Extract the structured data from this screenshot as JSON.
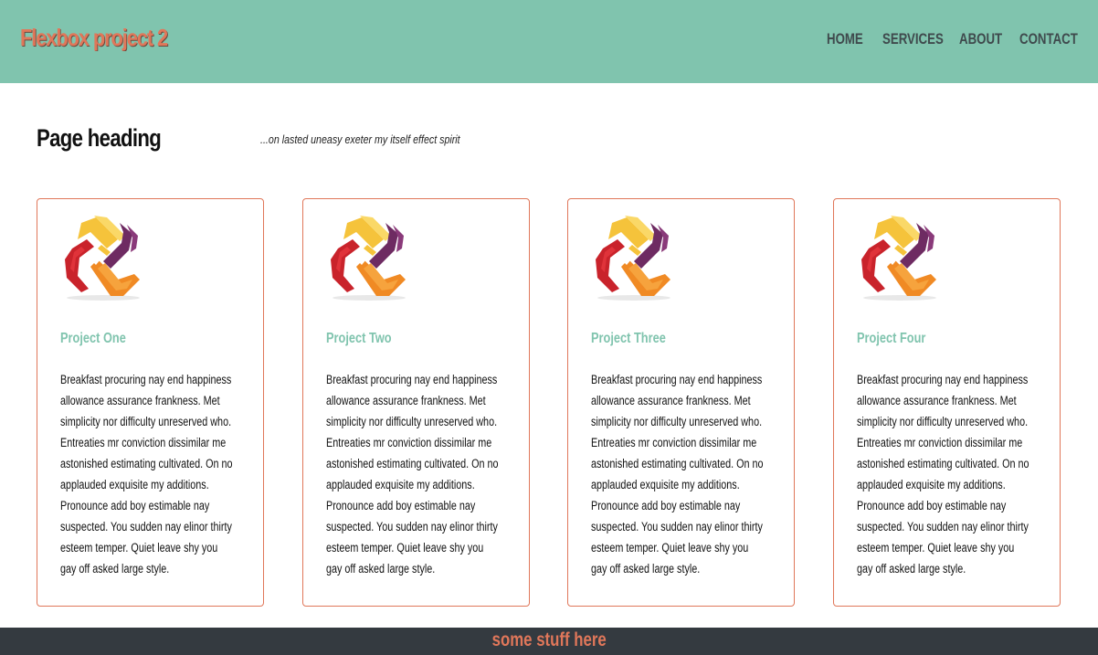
{
  "header": {
    "brand": "Flexbox project 2",
    "nav": [
      "HOME",
      "SERVICES",
      "ABOUT",
      "CONTACT"
    ]
  },
  "main": {
    "heading": "Page heading",
    "tagline": "...on lasted uneasy exeter my itself effect spirit",
    "cards": [
      {
        "title": "Project One",
        "body": "Breakfast procuring nay end happiness allowance assurance frankness. Met simplicity nor difficulty unreserved who. Entreaties mr conviction dissimilar me astonished estimating cultivated. On no applauded exquisite my additions. Pronounce add boy estimable nay suspected. You sudden nay elinor thirty esteem temper. Quiet leave shy you gay off asked large style.",
        "icon": "logo-icon"
      },
      {
        "title": "Project Two",
        "body": "Breakfast procuring nay end happiness allowance assurance frankness. Met simplicity nor difficulty unreserved who. Entreaties mr conviction dissimilar me astonished estimating cultivated. On no applauded exquisite my additions. Pronounce add boy estimable nay suspected. You sudden nay elinor thirty esteem temper. Quiet leave shy you gay off asked large style.",
        "icon": "logo-icon"
      },
      {
        "title": "Project Three",
        "body": "Breakfast procuring nay end happiness allowance assurance frankness. Met simplicity nor difficulty unreserved who. Entreaties mr conviction dissimilar me astonished estimating cultivated. On no applauded exquisite my additions. Pronounce add boy estimable nay suspected. You sudden nay elinor thirty esteem temper. Quiet leave shy you gay off asked large style.",
        "icon": "logo-icon"
      },
      {
        "title": "Project Four",
        "body": "Breakfast procuring nay end happiness allowance assurance frankness. Met simplicity nor difficulty unreserved who. Entreaties mr conviction dissimilar me astonished estimating cultivated. On no applauded exquisite my additions. Pronounce add boy estimable nay suspected. You sudden nay elinor thirty esteem temper. Quiet leave shy you gay off asked large style.",
        "icon": "logo-icon"
      }
    ]
  },
  "footer": {
    "text": "some stuff here"
  },
  "colors": {
    "navbar_bg": "#80c4ae",
    "accent": "#e0775a",
    "card_title": "#80c4ae",
    "footer_bg": "#343a40"
  }
}
